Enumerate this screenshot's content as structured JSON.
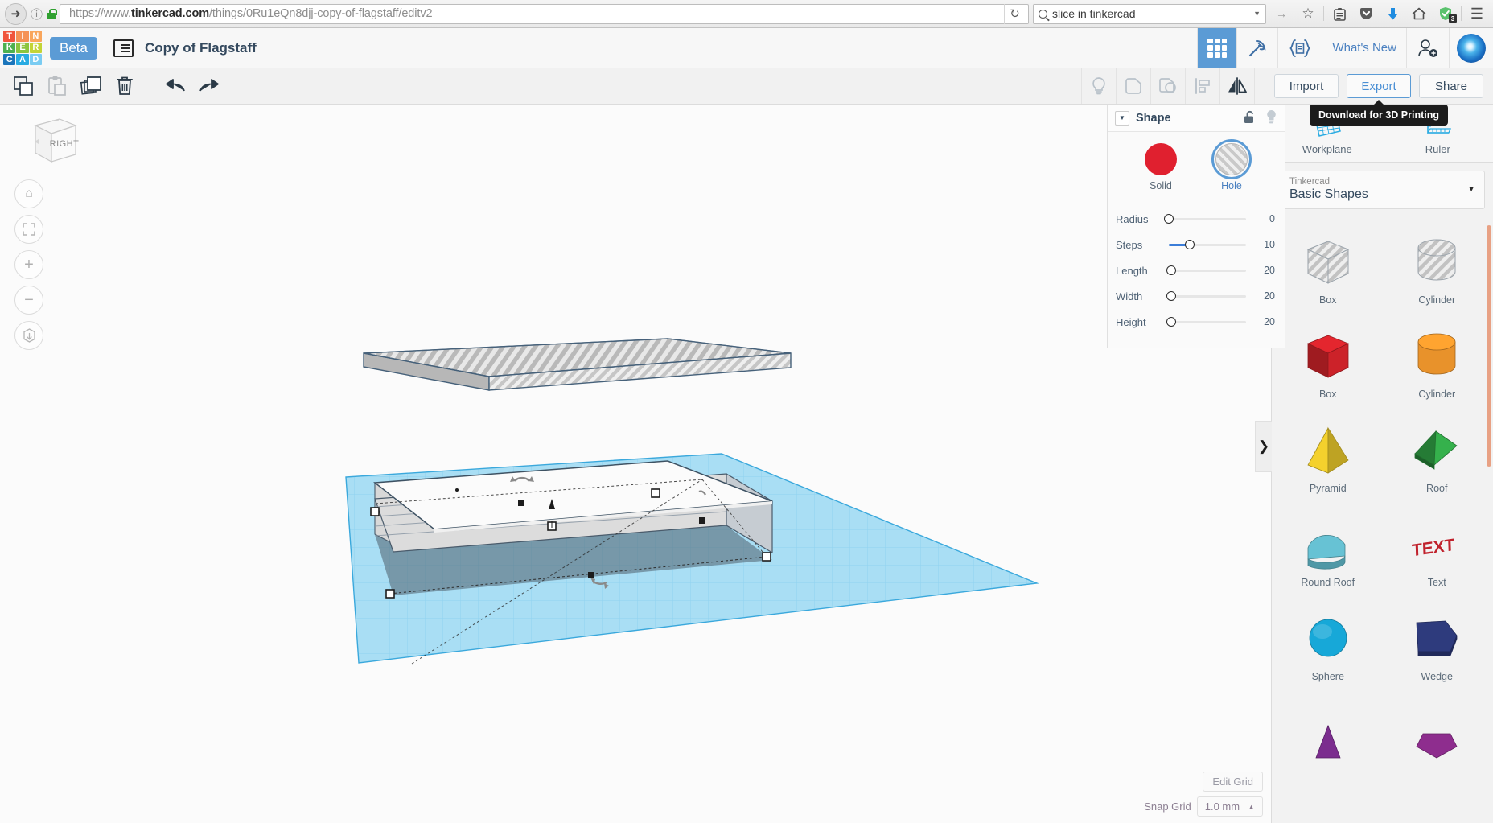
{
  "browser": {
    "back_icon": "back-arrow-icon",
    "info_icon": "info-icon",
    "lock_icon": "lock-icon",
    "url_prefix": "https://www.",
    "url_domain": "tinkercad.com",
    "url_path": "/things/0Ru1eQn8djj-copy-of-flagstaff/editv2",
    "url_full": "https://www.tinkercad.com/things/0Ru1eQn8djj-copy-of-flagstaff/editv2",
    "reload_icon": "reload-icon",
    "search_value": "slice in tinkercad",
    "toolbar_icons": [
      {
        "name": "forward-arrow-icon",
        "glyph": "→"
      },
      {
        "name": "bookmark-star-icon",
        "glyph": "☆"
      },
      {
        "name": "library-icon",
        "glyph": "὜b"
      },
      {
        "name": "pocket-icon",
        "glyph": "▽"
      },
      {
        "name": "download-icon",
        "glyph": "⬇"
      },
      {
        "name": "home-icon",
        "glyph": "⌂"
      },
      {
        "name": "shield-icon",
        "glyph": "✓",
        "badge": "3"
      },
      {
        "name": "menu-hamburger-icon",
        "glyph": "☰"
      }
    ]
  },
  "header": {
    "logo_tiles": [
      {
        "letter": "T",
        "color": "#f0553d"
      },
      {
        "letter": "I",
        "color": "#f59256"
      },
      {
        "letter": "N",
        "color": "#f9a65c"
      },
      {
        "letter": "K",
        "color": "#4cb050"
      },
      {
        "letter": "E",
        "color": "#8bc53f"
      },
      {
        "letter": "R",
        "color": "#c3d435"
      },
      {
        "letter": "C",
        "color": "#1b75bb"
      },
      {
        "letter": "A",
        "color": "#29abe2"
      },
      {
        "letter": "D",
        "color": "#7accf2"
      }
    ],
    "beta_label": "Beta",
    "doc_list_icon": "document-list-icon",
    "doc_title": "Copy of Flagstaff",
    "nav_items": [
      {
        "name": "tab-shapes-grid",
        "icon": "grid-icon",
        "active": true
      },
      {
        "name": "tab-blocks",
        "icon": "pickaxe-icon",
        "active": false
      },
      {
        "name": "tab-codeblocks",
        "icon": "codeblock-icon",
        "active": false
      }
    ],
    "whats_new": "What's New",
    "invite_icon": "add-user-icon",
    "avatar": "user-avatar"
  },
  "toolbar": {
    "left_tools": [
      {
        "name": "copy-button",
        "icon": "copy-icon",
        "disabled": false
      },
      {
        "name": "paste-button",
        "icon": "paste-icon",
        "disabled": true
      },
      {
        "name": "duplicate-button",
        "icon": "duplicate-icon",
        "disabled": false
      },
      {
        "name": "delete-button",
        "icon": "trash-icon",
        "disabled": false
      }
    ],
    "history_tools": [
      {
        "name": "undo-button",
        "icon": "undo-arrow-icon"
      },
      {
        "name": "redo-button",
        "icon": "redo-arrow-icon"
      }
    ],
    "right_tools": [
      {
        "name": "hint-button",
        "icon": "lightbulb-icon"
      },
      {
        "name": "group-button",
        "icon": "group-shapes-icon"
      },
      {
        "name": "ungroup-button",
        "icon": "ungroup-shapes-icon"
      },
      {
        "name": "align-button",
        "icon": "align-icon"
      },
      {
        "name": "mirror-button",
        "icon": "mirror-icon"
      }
    ],
    "import_label": "Import",
    "export_label": "Export",
    "share_label": "Share",
    "export_tooltip": "Download for 3D Printing"
  },
  "viewport": {
    "view_cube_label": "RIGHT",
    "nav_buttons": [
      {
        "name": "home-view-button",
        "icon": "home-icon",
        "glyph": "⌂"
      },
      {
        "name": "fit-view-button",
        "icon": "fit-all-icon",
        "glyph": "⤢"
      },
      {
        "name": "zoom-in-button",
        "icon": "plus-icon",
        "glyph": "+"
      },
      {
        "name": "zoom-out-button",
        "icon": "minus-icon",
        "glyph": "−"
      },
      {
        "name": "ortho-toggle-button",
        "icon": "perspective-box-icon",
        "glyph": "⬡"
      }
    ],
    "edit_grid_label": "Edit Grid",
    "snap_grid_label": "Snap Grid",
    "snap_grid_value": "1.0 mm",
    "snap_caret": "▲"
  },
  "inspector": {
    "collapse_icon": "chevron-down-icon",
    "title": "Shape",
    "lock_icon": "unlock-icon",
    "bulb_icon": "lightbulb-icon",
    "solid_label": "Solid",
    "hole_label": "Hole",
    "solid_color": "#e0202f",
    "selected_mode": "Hole",
    "sliders": [
      {
        "label": "Radius",
        "value": "0",
        "pct": 0
      },
      {
        "label": "Steps",
        "value": "10",
        "pct": 27
      },
      {
        "label": "Length",
        "value": "20",
        "pct": 3
      },
      {
        "label": "Width",
        "value": "20",
        "pct": 3
      },
      {
        "label": "Height",
        "value": "20",
        "pct": 3
      }
    ]
  },
  "sidebar": {
    "panel_toggle_icon": "chevron-right-icon",
    "tool_tabs": [
      {
        "name": "workplane-tool",
        "label": "Workplane",
        "icon": "workplane-icon"
      },
      {
        "name": "ruler-tool",
        "label": "Ruler",
        "icon": "ruler-icon"
      }
    ],
    "library_owner": "Tinkercad",
    "library_name": "Basic Shapes",
    "library_caret": "▼",
    "shapes": [
      {
        "label": "Box",
        "kind": "box",
        "color": "hatch"
      },
      {
        "label": "Cylinder",
        "kind": "cylinder",
        "color": "hatch"
      },
      {
        "label": "Box",
        "kind": "box",
        "color": "#cc2229"
      },
      {
        "label": "Cylinder",
        "kind": "cylinder",
        "color": "#e8922b"
      },
      {
        "label": "Pyramid",
        "kind": "pyramid",
        "color": "#e8c72b"
      },
      {
        "label": "Roof",
        "kind": "roof",
        "color": "#2f9e44"
      },
      {
        "label": "Round Roof",
        "kind": "roundroof",
        "color": "#62b9ca"
      },
      {
        "label": "Text",
        "kind": "text",
        "color": "#c0212c"
      },
      {
        "label": "Sphere",
        "kind": "sphere",
        "color": "#17a8d8"
      },
      {
        "label": "Wedge",
        "kind": "wedge",
        "color": "#2e3b7d"
      },
      {
        "label": "",
        "kind": "cone",
        "color": "#7b2d8e"
      },
      {
        "label": "",
        "kind": "polygon",
        "color": "#8e2d8e"
      }
    ]
  }
}
